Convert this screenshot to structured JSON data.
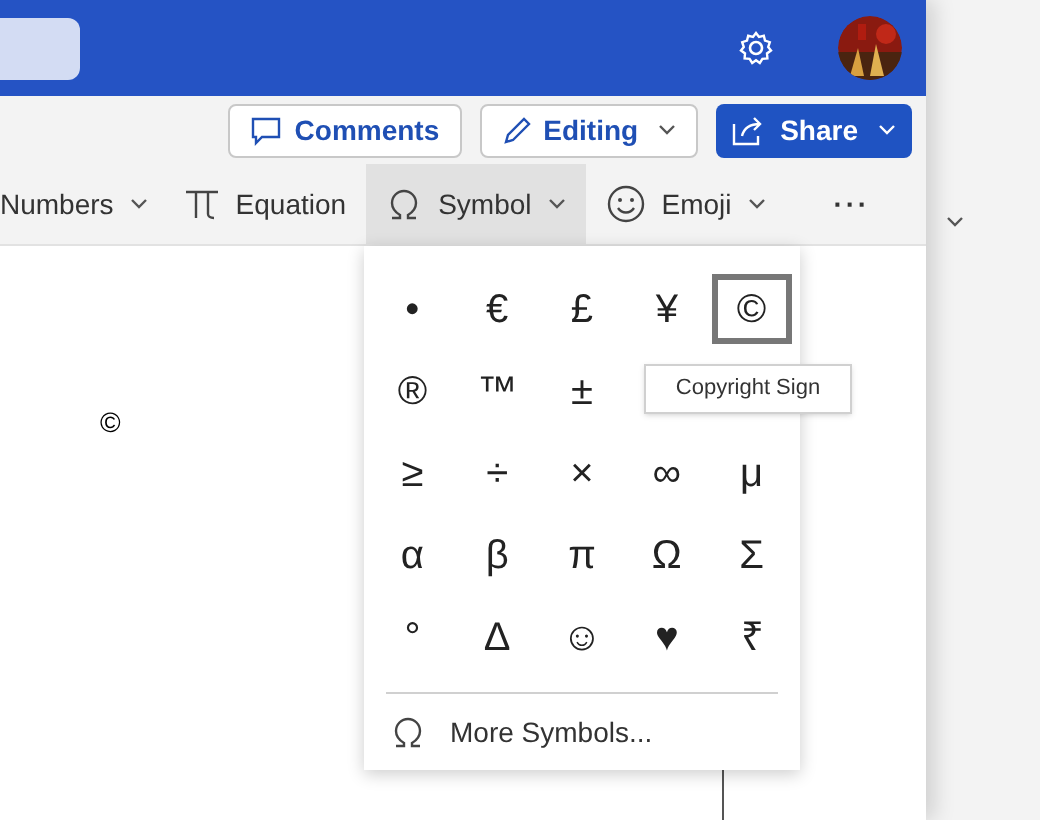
{
  "actions": [
    {
      "kind": "comments",
      "label": "Comments"
    },
    {
      "kind": "editing",
      "label": "Editing"
    },
    {
      "kind": "share",
      "label": "Share"
    }
  ],
  "ribbon": [
    {
      "kind": "numbers",
      "label": "Numbers",
      "selected": false
    },
    {
      "kind": "equation",
      "label": "Equation",
      "selected": false
    },
    {
      "kind": "symbol",
      "label": "Symbol",
      "selected": true
    },
    {
      "kind": "emoji",
      "label": "Emoji",
      "selected": false
    },
    {
      "kind": "more",
      "label": "···",
      "selected": false
    }
  ],
  "document": {
    "text": "©"
  },
  "symbol_menu": {
    "rows": [
      [
        {
          "symbol": "•",
          "selected": false
        },
        {
          "symbol": "€",
          "selected": false
        },
        {
          "symbol": "£",
          "selected": false
        },
        {
          "symbol": "¥",
          "selected": false
        },
        {
          "symbol": "©",
          "selected": true
        }
      ],
      [
        {
          "symbol": "®",
          "selected": false
        },
        {
          "symbol": "™",
          "selected": false
        },
        {
          "symbol": "±",
          "selected": false
        }
      ],
      [
        {
          "symbol": "≥",
          "selected": false
        },
        {
          "symbol": "÷",
          "selected": false
        },
        {
          "symbol": "×",
          "selected": false
        },
        {
          "symbol": "∞",
          "selected": false
        },
        {
          "symbol": "μ",
          "selected": false
        }
      ],
      [
        {
          "symbol": "α",
          "selected": false
        },
        {
          "symbol": "β",
          "selected": false
        },
        {
          "symbol": "π",
          "selected": false
        },
        {
          "symbol": "Ω",
          "selected": false
        },
        {
          "symbol": "Σ",
          "selected": false
        }
      ],
      [
        {
          "symbol": "°",
          "selected": false
        },
        {
          "symbol": "Δ",
          "selected": false
        },
        {
          "symbol": "☺",
          "selected": false
        },
        {
          "symbol": "♥",
          "selected": false
        },
        {
          "symbol": "₹",
          "selected": false
        }
      ]
    ],
    "tooltip": "Copyright Sign",
    "more_label": "More Symbols..."
  }
}
